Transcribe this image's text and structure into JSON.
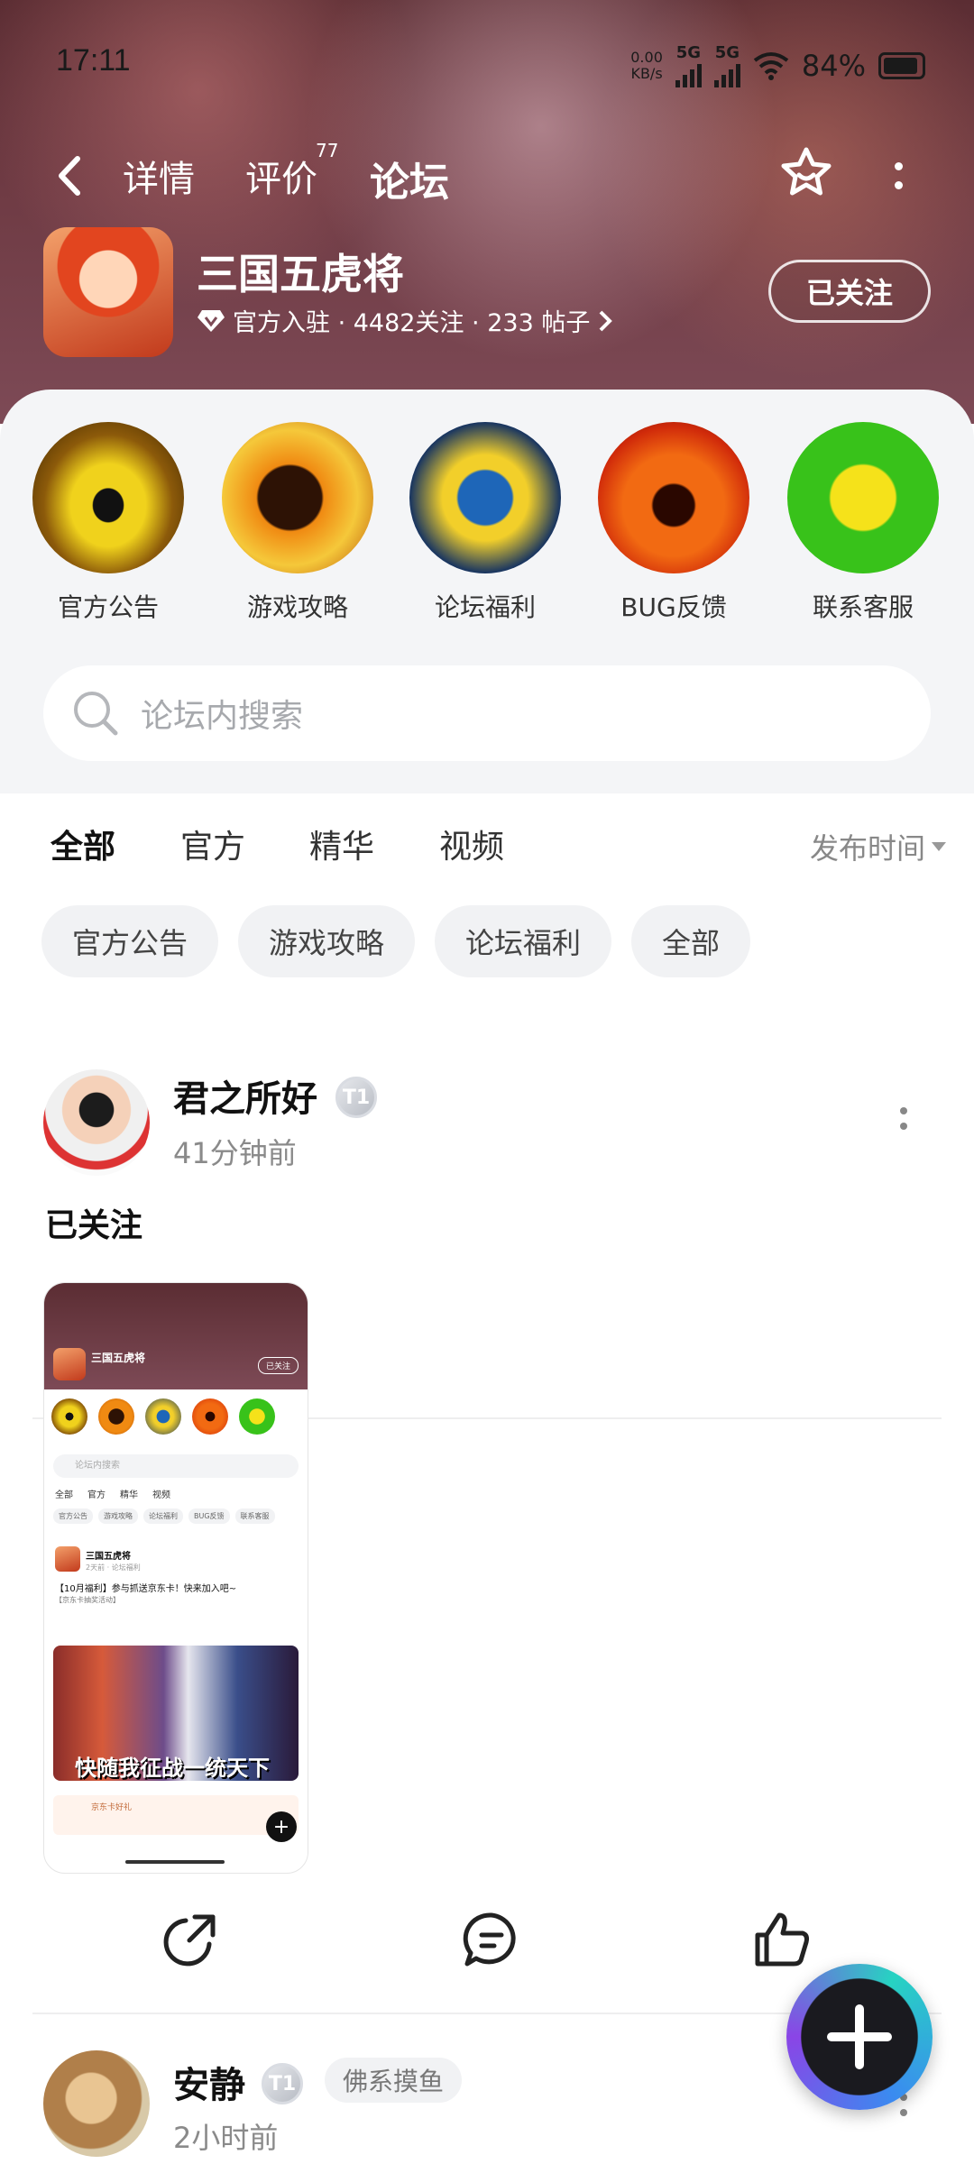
{
  "status_bar": {
    "time": "17:11",
    "net_speed_value": "0.00",
    "net_speed_unit": "KB/s",
    "net_type_1": "5G",
    "net_type_2": "5G",
    "battery": "84%"
  },
  "nav": {
    "tabs": [
      {
        "label": "详情"
      },
      {
        "label": "评价"
      },
      {
        "label": "论坛"
      }
    ],
    "review_count": "77",
    "active_tab": "论坛"
  },
  "forum": {
    "name": "三国五虎将",
    "meta": "官方入驻 · 4482关注 · 233 帖子",
    "follow_label": "已关注"
  },
  "quick_links": [
    {
      "label": "官方公告"
    },
    {
      "label": "游戏攻略"
    },
    {
      "label": "论坛福利"
    },
    {
      "label": "BUG反馈"
    },
    {
      "label": "联系客服"
    }
  ],
  "search": {
    "placeholder": "论坛内搜索"
  },
  "filter_tabs": [
    {
      "label": "全部"
    },
    {
      "label": "官方"
    },
    {
      "label": "精华"
    },
    {
      "label": "视频"
    }
  ],
  "sort_label": "发布时间",
  "chips": [
    {
      "label": "官方公告"
    },
    {
      "label": "游戏攻略"
    },
    {
      "label": "论坛福利"
    },
    {
      "label": "全部"
    }
  ],
  "posts": [
    {
      "author": "君之所好",
      "level": "T1",
      "time": "41分钟前",
      "title": "已关注",
      "screenshot": {
        "forum_name": "三国五虎将",
        "follow": "已关注",
        "search": "论坛内搜索",
        "tabs": [
          "全部",
          "官方",
          "精华",
          "视频"
        ],
        "chips": [
          "官方公告",
          "游戏攻略",
          "论坛福利",
          "BUG反馈",
          "联系客服"
        ],
        "post_author": "三国五虎将",
        "post_time": "2天前 · 论坛福利",
        "post_title": "【10月福利】参与抓送京东卡！快来加入吧~",
        "post_sub": "【京东卡抽奖活动】",
        "banner_text": "快随我征战一统天下",
        "strip_text": "京东卡好礼"
      }
    },
    {
      "author": "安静",
      "level": "T1",
      "tag": "佛系摸鱼",
      "time": "2小时前"
    }
  ],
  "colors": {
    "accent": "#19c6b2",
    "hero_bg": "#6f3b44"
  }
}
